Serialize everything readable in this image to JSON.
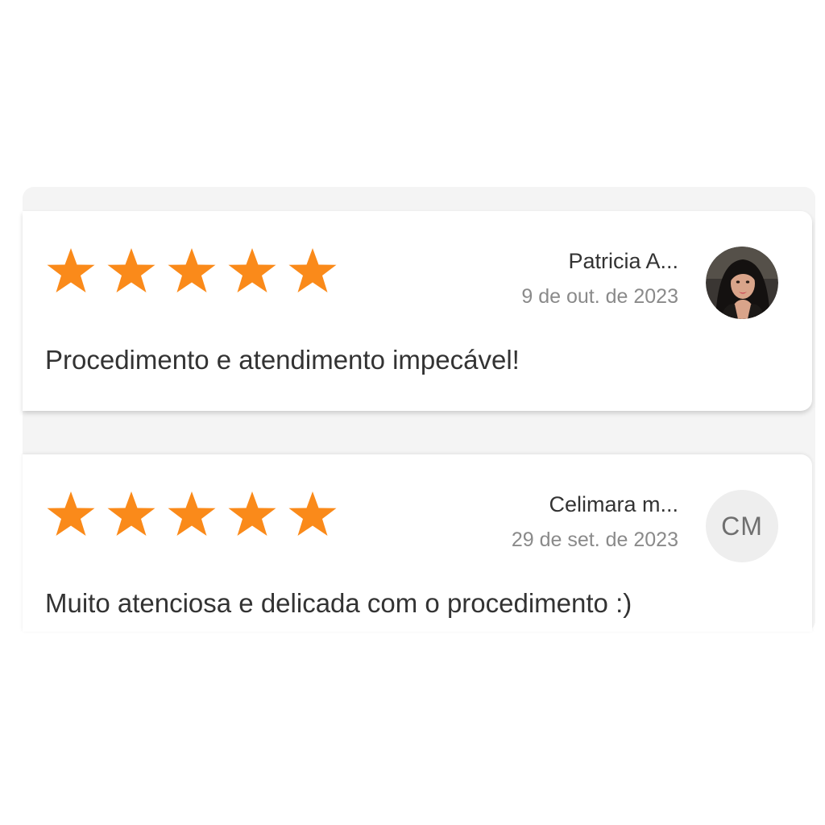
{
  "colors": {
    "star": "#FA8A1A",
    "text_primary": "#333333",
    "text_secondary": "#8A8A8A",
    "avatar_placeholder_bg": "#EEEEEE"
  },
  "reviews": [
    {
      "rating": 5,
      "reviewer_name": "Patricia A...",
      "date": "9 de out. de 2023",
      "avatar": "photo",
      "text": "Procedimento e atendimento impecável!"
    },
    {
      "rating": 5,
      "reviewer_name": "Celimara m...",
      "date": "29 de set. de 2023",
      "avatar_initials": "CM",
      "text": "Muito atenciosa e delicada com o procedimento :)"
    }
  ]
}
